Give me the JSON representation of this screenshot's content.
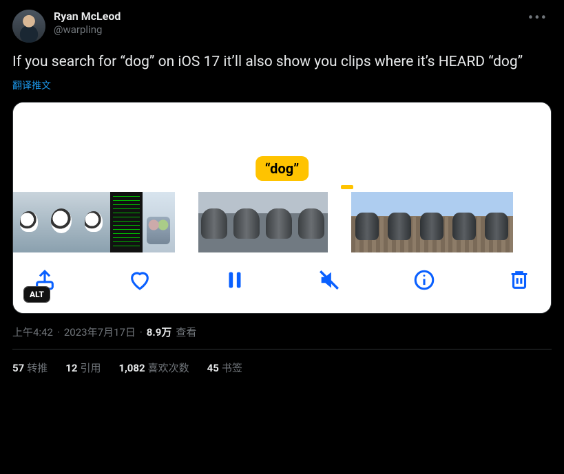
{
  "author": {
    "display_name": "Ryan McLeod",
    "handle": "@warpling"
  },
  "tweet_text": "If you search for “dog” on iOS 17 it’ll also show you clips where it’s HEARD “dog”",
  "translate_label": "翻译推文",
  "media": {
    "pill_text": "“dog”",
    "alt_badge": "ALT",
    "toolbar": {
      "share": "share-icon",
      "heart": "heart-icon",
      "pause": "pause-icon",
      "mute": "mute-icon",
      "info": "info-icon",
      "trash": "trash-icon"
    }
  },
  "meta": {
    "time": "上午4:42",
    "sep": "·",
    "date": "2023年7月17日",
    "views_strong": "8.9万",
    "views_label": "查看"
  },
  "stats": {
    "retweets_n": "57",
    "retweets_label": "转推",
    "quotes_n": "12",
    "quotes_label": "引用",
    "likes_n": "1,082",
    "likes_label": "喜欢次数",
    "bookmarks_n": "45",
    "bookmarks_label": "书签"
  }
}
